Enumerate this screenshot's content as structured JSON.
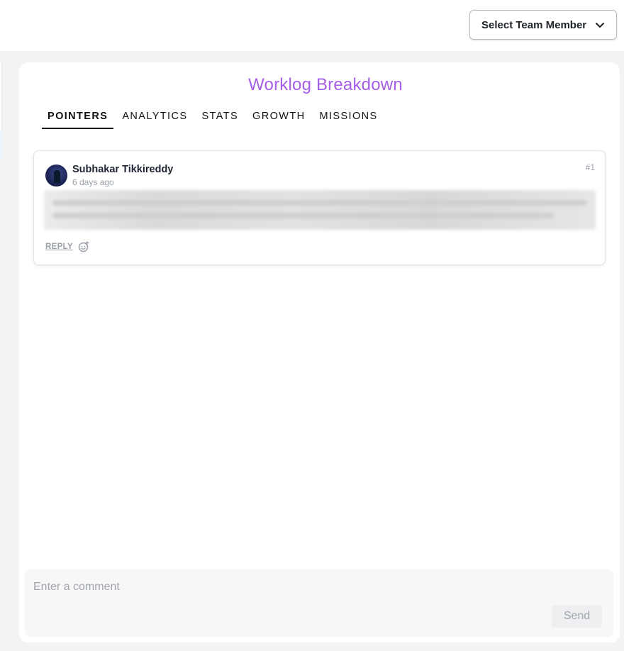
{
  "header": {
    "team_select_label": "Select Team Member",
    "team_select_icon": "chevron-down-icon"
  },
  "panel": {
    "title": "Worklog Breakdown",
    "title_color": "#a55ee8",
    "tabs": [
      {
        "label": "POINTERS",
        "active": true
      },
      {
        "label": "ANALYTICS",
        "active": false
      },
      {
        "label": "STATS",
        "active": false
      },
      {
        "label": "GROWTH",
        "active": false
      },
      {
        "label": "MISSIONS",
        "active": false
      }
    ]
  },
  "comments": [
    {
      "author": "Subhakar Tikkireddy",
      "time": "6 days ago",
      "number": "#1",
      "reply_label": "REPLY",
      "reaction_icon": "add-emoji-icon"
    }
  ],
  "composer": {
    "placeholder": "Enter a comment",
    "value": "",
    "send_label": "Send"
  }
}
